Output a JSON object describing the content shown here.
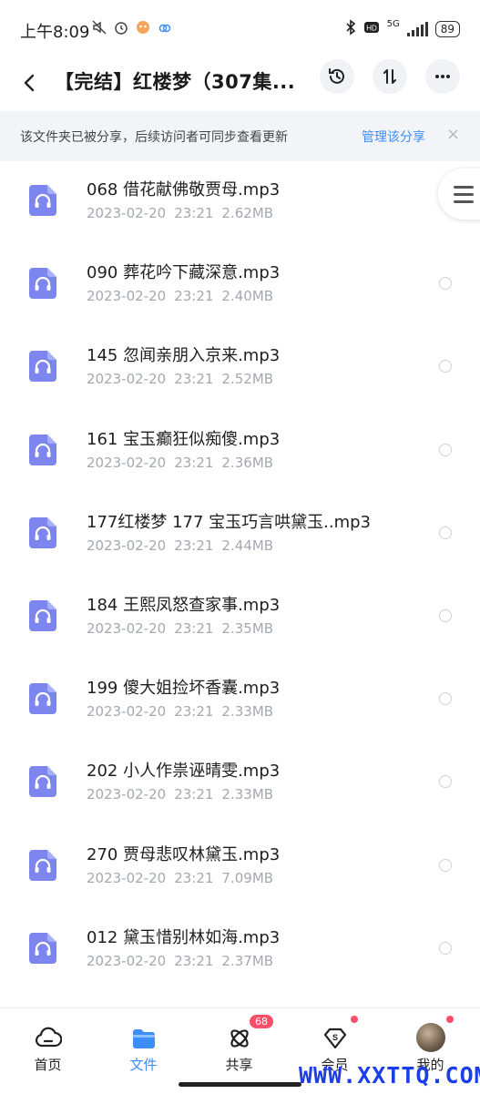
{
  "status_bar": {
    "time": "上午8:09",
    "network": "5G",
    "battery": "89"
  },
  "header": {
    "title": "【完结】红楼梦（307集..."
  },
  "banner": {
    "text": "该文件夹已被分享，后续访问者可同步查看更新",
    "link": "管理该分享",
    "close": "×"
  },
  "files": [
    {
      "name": "068 借花献佛敬贾母.mp3",
      "date": "2023-02-20",
      "time": "23:21",
      "size": "2.62MB"
    },
    {
      "name": "090 葬花吟下藏深意.mp3",
      "date": "2023-02-20",
      "time": "23:21",
      "size": "2.40MB"
    },
    {
      "name": "145 忽闻亲朋入京来.mp3",
      "date": "2023-02-20",
      "time": "23:21",
      "size": "2.52MB"
    },
    {
      "name": "161 宝玉癫狂似痴傻.mp3",
      "date": "2023-02-20",
      "time": "23:21",
      "size": "2.36MB"
    },
    {
      "name": "177红楼梦 177 宝玉巧言哄黛玉..mp3",
      "date": "2023-02-20",
      "time": "23:21",
      "size": "2.44MB"
    },
    {
      "name": "184 王熙凤怒查家事.mp3",
      "date": "2023-02-20",
      "time": "23:21",
      "size": "2.35MB"
    },
    {
      "name": "199 傻大姐捡坏香囊.mp3",
      "date": "2023-02-20",
      "time": "23:21",
      "size": "2.33MB"
    },
    {
      "name": "202 小人作祟诬晴雯.mp3",
      "date": "2023-02-20",
      "time": "23:21",
      "size": "2.33MB"
    },
    {
      "name": "270 贾母悲叹林黛玉.mp3",
      "date": "2023-02-20",
      "time": "23:21",
      "size": "7.09MB"
    },
    {
      "name": "012 黛玉惜别林如海.mp3",
      "date": "2023-02-20",
      "time": "23:21",
      "size": "2.37MB"
    }
  ],
  "nav": {
    "home": "首页",
    "files": "文件",
    "share": "共享",
    "share_badge": "68",
    "member": "会员",
    "mine": "我的"
  },
  "watermark": "WWW.XXTTQ.COM",
  "colors": {
    "accent": "#3d8ef8",
    "file_icon": "#7d86ef",
    "badge": "#ff4d6a"
  }
}
